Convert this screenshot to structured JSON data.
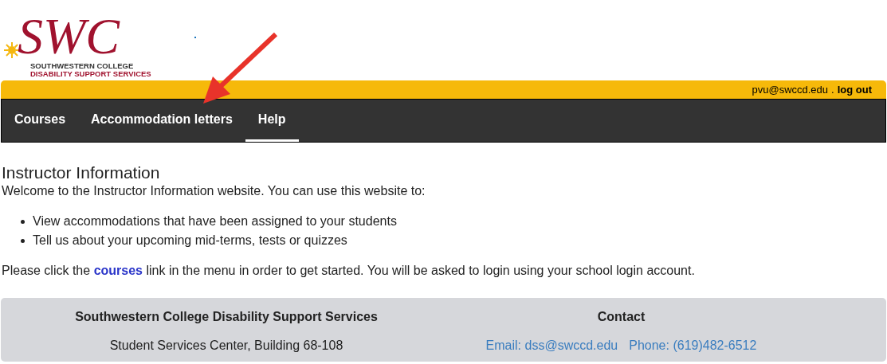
{
  "logo": {
    "mark": "SWC",
    "line1": "SOUTHWESTERN COLLEGE",
    "line2": "DISABILITY SUPPORT SERVICES"
  },
  "user_bar": {
    "email": "pvu@swccd.edu",
    "separator": ".",
    "logout": "log out"
  },
  "nav": [
    {
      "label": "Courses",
      "selected": false
    },
    {
      "label": "Accommodation letters",
      "selected": false
    },
    {
      "label": "Help",
      "selected": true
    }
  ],
  "annotation": {
    "kind": "arrow"
  },
  "content": {
    "title": "Instructor Information",
    "intro": "Welcome to the Instructor Information website. You can use this website to:",
    "bullets": [
      "View accommodations that have been assigned to your students",
      "Tell us about your upcoming mid-terms, tests or quizzes"
    ],
    "before_link": "Please click the",
    "link": "courses",
    "after_link": "link in the menu in order to get started. You will be asked to login using your school login account."
  },
  "footer": {
    "org_title": "Southwestern College Disability Support Services",
    "address": "Student Services Center, Building 68-108",
    "contact_title": "Contact",
    "email": "Email: dss@swccd.edu",
    "phone": "Phone: (619)482-6512"
  }
}
